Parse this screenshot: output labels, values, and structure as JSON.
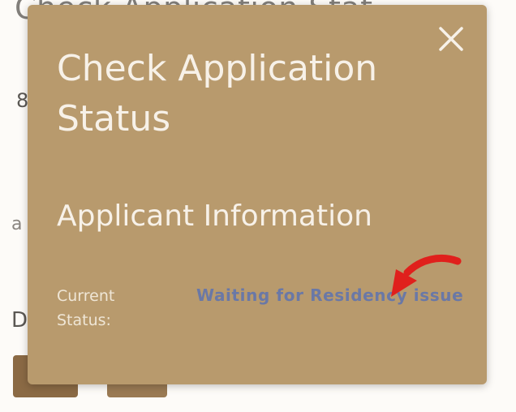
{
  "background": {
    "title": "Check Application Stat",
    "fragment_a": "8",
    "fragment_b": "a",
    "fragment_c": "D"
  },
  "modal": {
    "title": "Check Application Status",
    "section_title": "Applicant Information",
    "current_status_label": "Current Status:",
    "current_status_value": "Waiting for Residency issue",
    "close_icon": "close-icon"
  },
  "colors": {
    "modal_bg": "#b89a6d",
    "status_text": "#6a78a6",
    "arrow": "#e0201c",
    "button_bg": "#8b6a45"
  }
}
